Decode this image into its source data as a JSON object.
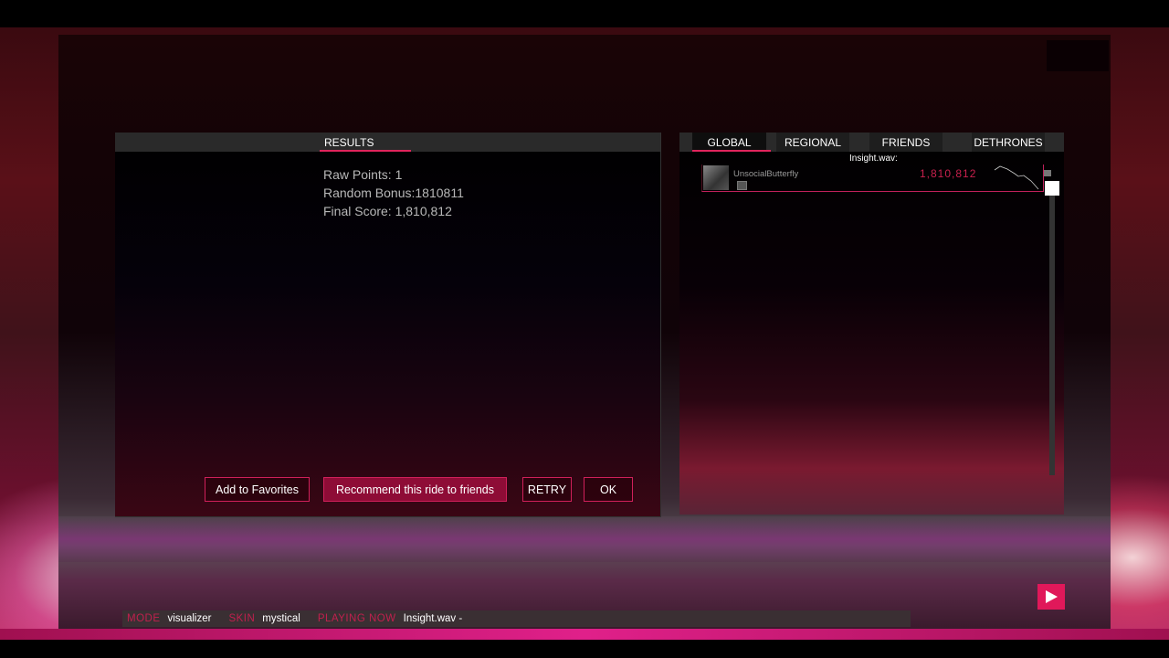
{
  "results": {
    "tab_label": "RESULTS",
    "raw_points": "Raw Points: 1",
    "random_bonus": "Random Bonus:1810811",
    "final_score": "Final Score: 1,810,812",
    "buttons": {
      "favorites": "Add to Favorites",
      "recommend": "Recommend this ride to friends",
      "retry": "RETRY",
      "ok": "OK"
    }
  },
  "leaderboard": {
    "tabs": [
      {
        "label": "GLOBAL",
        "active": true
      },
      {
        "label": "REGIONAL",
        "active": false
      },
      {
        "label": "FRIENDS",
        "active": false
      },
      {
        "label": "DETHRONES",
        "active": false
      }
    ],
    "song_title": "Insight.wav:",
    "entries": [
      {
        "username": "UnsocialButterfly",
        "score": "1,810,812"
      }
    ]
  },
  "statusbar": {
    "mode_label": "MODE",
    "mode_value": "visualizer",
    "skin_label": "SKIN",
    "skin_value": "mystical",
    "playing_label": "PLAYING NOW",
    "playing_value": "Insight.wav -"
  },
  "colors": {
    "accent": "#e0245c",
    "score": "#c8204e"
  },
  "icons": {
    "play": "play-icon"
  }
}
